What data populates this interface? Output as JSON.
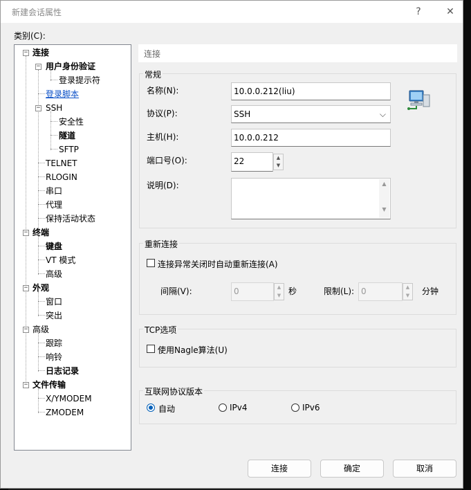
{
  "window": {
    "title": "新建会话属性",
    "help": "?",
    "close": "✕"
  },
  "category_label": "类别(C):",
  "tree": {
    "connection": "连接",
    "user_auth": "用户身份验证",
    "login_prompt": "登录提示符",
    "login_script": "登录脚本",
    "ssh": "SSH",
    "security": "安全性",
    "tunnel": "隧道",
    "sftp": "SFTP",
    "telnet": "TELNET",
    "rlogin": "RLOGIN",
    "serial": "串口",
    "proxy": "代理",
    "keepalive": "保持活动状态",
    "terminal": "终端",
    "keyboard": "键盘",
    "vt_mode": "VT 模式",
    "advanced_t": "高级",
    "appearance": "外观",
    "window": "窗口",
    "highlight": "突出",
    "advanced": "高级",
    "trace": "跟踪",
    "bell": "响铃",
    "logging": "日志记录",
    "file_transfer": "文件传输",
    "xymodem": "X/YMODEM",
    "zmodem": "ZMODEM"
  },
  "panel": {
    "header": "连接",
    "general": {
      "title": "常规",
      "name_label": "名称(N):",
      "name_value": "10.0.0.212(liu)",
      "protocol_label": "协议(P):",
      "protocol_value": "SSH",
      "host_label": "主机(H):",
      "host_value": "10.0.0.212",
      "port_label": "端口号(O):",
      "port_value": "22",
      "desc_label": "说明(D):",
      "desc_value": ""
    },
    "reconnect": {
      "title": "重新连接",
      "auto_label": "连接异常关闭时自动重新连接(A)",
      "auto_checked": false,
      "interval_label": "间隔(V):",
      "interval_value": "0",
      "interval_unit": "秒",
      "limit_label": "限制(L):",
      "limit_value": "0",
      "limit_unit": "分钟"
    },
    "tcp": {
      "title": "TCP选项",
      "nagle_label": "使用Nagle算法(U)",
      "nagle_checked": false
    },
    "ip": {
      "title": "互联网协议版本",
      "options": [
        "自动",
        "IPv4",
        "IPv6"
      ],
      "selected": "自动"
    }
  },
  "buttons": {
    "connect": "连接",
    "ok": "确定",
    "cancel": "取消"
  },
  "colors": {
    "accent": "#005fb8",
    "link": "#0a4fc7"
  }
}
